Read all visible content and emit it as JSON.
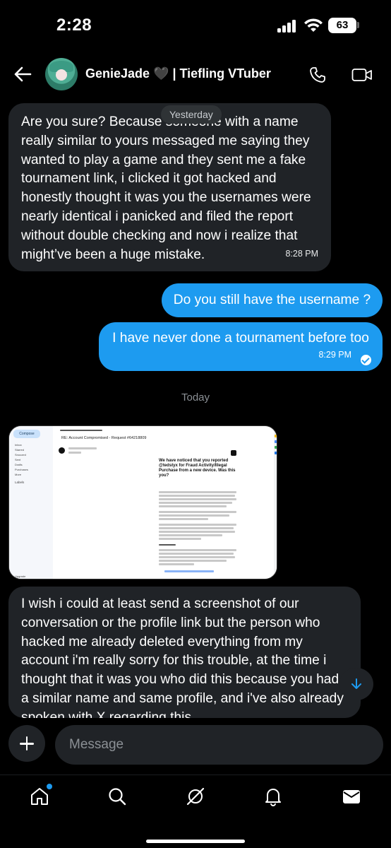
{
  "status_bar": {
    "time": "2:28",
    "battery": "63"
  },
  "header": {
    "contact_name": "GenieJade 🖤 | Tiefling VTuber"
  },
  "day_labels": {
    "yesterday": "Yesterday",
    "today": "Today"
  },
  "messages": [
    {
      "direction": "incoming",
      "text": "Are you sure? Because someone with a name really similar to yours messaged me saying they wanted to play a game and they sent me a fake tournament link, i clicked it got hacked and honestly thought it was you the usernames were nearly identical i panicked and filed the report without double checking and now i realize that might’ve been a huge mistake.",
      "time": "8:28 PM"
    },
    {
      "direction": "outgoing",
      "text": "Do you still have the username ?",
      "time": ""
    },
    {
      "direction": "outgoing",
      "text": "I have never done a tournament before too",
      "time": "8:29 PM",
      "status": "read"
    },
    {
      "direction": "incoming",
      "text": "I wish i could at least send a screenshot of our conversation or the profile link but the person who hacked me already deleted everything from my account i'm really sorry for this trouble, at the time i thought that it was you who did this because you had a similar name and same profile, and i've also already spoken with X regarding this"
    }
  ],
  "attachment": {
    "compose": "Compose",
    "nav": [
      "Inbox",
      "Starred",
      "Snoozed",
      "Sent",
      "Drafts",
      "Purchases",
      "More"
    ],
    "labels_heading": "Labels",
    "upgrade": "Upgrade",
    "email_subject": "RE: Account Compromised - Request #64218809",
    "email_headline": "We have noticed that you reported @tedstyx for Fraud Activity/Illegal Purchase from a new device. Was this you?"
  },
  "composer": {
    "placeholder": "Message"
  },
  "tabs": [
    "home",
    "search",
    "grok",
    "notifications",
    "messages"
  ],
  "colors": {
    "accent": "#1d9bf0",
    "incoming_bubble": "#202327",
    "background": "#000000"
  }
}
